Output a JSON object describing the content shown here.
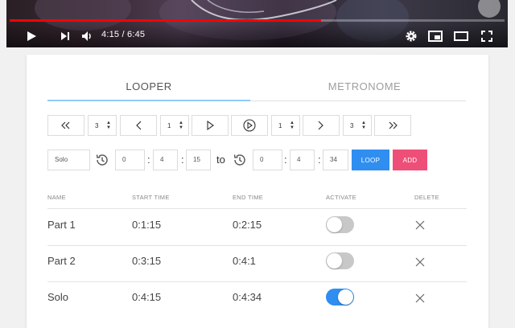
{
  "player": {
    "current_time": "4:15",
    "duration": "6:45",
    "progress_fraction": 0.629
  },
  "tabs": [
    {
      "label": "LOOPER",
      "active": true
    },
    {
      "label": "METRONOME",
      "active": false
    }
  ],
  "transport": {
    "rewind_steps": "3",
    "back_steps": "1",
    "loop_play_count": "1",
    "forward_steps": "3"
  },
  "range": {
    "name_value": "Solo",
    "start": {
      "h": "0",
      "m": "4",
      "s": "15"
    },
    "to_label": "to",
    "end": {
      "h": "0",
      "m": "4",
      "s": "34"
    },
    "loop_label": "LOOP",
    "add_label": "ADD"
  },
  "table": {
    "headers": {
      "name": "NAME",
      "start": "START TIME",
      "end": "END TIME",
      "activate": "ACTIVATE",
      "delete": "DELETE"
    },
    "rows": [
      {
        "name": "Part 1",
        "start": "0:1:15",
        "end": "0:2:15",
        "active": false
      },
      {
        "name": "Part 2",
        "start": "0:3:15",
        "end": "0:4:1",
        "active": false
      },
      {
        "name": "Solo",
        "start": "0:4:15",
        "end": "0:4:34",
        "active": true
      }
    ]
  },
  "colors": {
    "accent_blue": "#2f8ef0",
    "add_pink": "#ee4f78",
    "toggle_on": "#2f8ef0",
    "toggle_off": "#c8c8c8",
    "progress_red": "#ff0000"
  },
  "icons": {
    "play": "play-icon",
    "next": "next-icon",
    "volume": "volume-icon",
    "settings": "gear-icon",
    "miniplayer": "miniplayer-icon",
    "theater": "theater-icon",
    "fullscreen": "fullscreen-icon",
    "history": "history-icon",
    "delete": "close-icon"
  }
}
